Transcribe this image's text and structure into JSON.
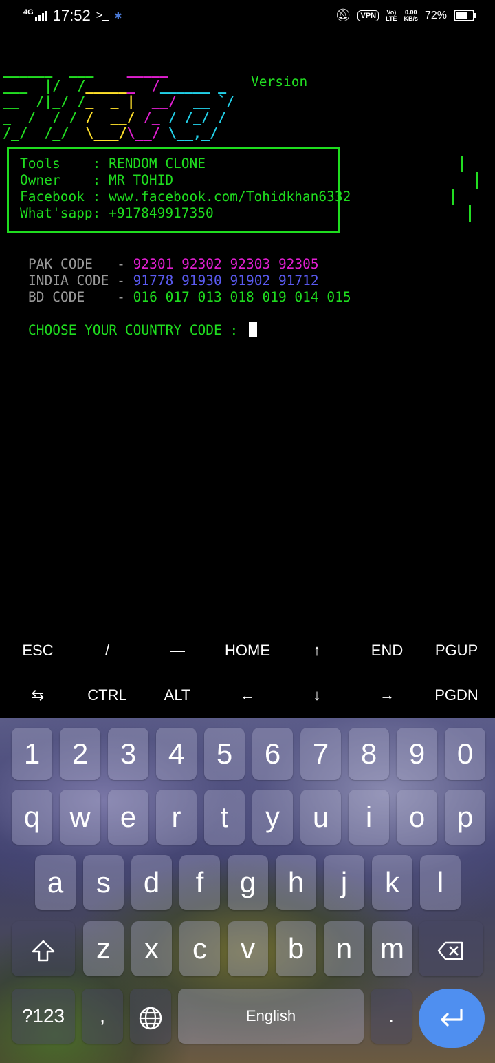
{
  "status_bar": {
    "network": "4G",
    "time": "17:52",
    "terminal_glyph": ">_",
    "vpn": "VPN",
    "volte_top": "Vo)",
    "volte_bottom": "LTE",
    "speed_top": "0.00",
    "speed_bottom": "KB/s",
    "battery": "72%",
    "battery_level": 0.72
  },
  "terminal": {
    "version_label": "Version",
    "info": {
      "tools": "Tools    : RENDOM CLONE",
      "owner": "Owner    : MR TOHID",
      "facebook": "Facebook : www.facebook.com/Tohidkhan6332",
      "whatsapp": "What'sapp: +917849917350"
    },
    "codes": [
      {
        "label": "PAK CODE   - ",
        "values": "92301 92302 92303 92305"
      },
      {
        "label": "INDIA CODE - ",
        "values": "91778 91930 91902 91712"
      },
      {
        "label": "BD CODE    - ",
        "values": "016 017 013 018 019 014 015"
      }
    ],
    "prompt": "CHOOSE YOUR COUNTRY CODE : "
  },
  "extra_keys": {
    "row1": [
      "ESC",
      "/",
      "—",
      "HOME",
      "↑",
      "END",
      "PGUP"
    ],
    "row2": [
      "⇆",
      "CTRL",
      "ALT",
      "←",
      "↓",
      "→",
      "PGDN"
    ]
  },
  "keyboard": {
    "numbers": [
      "1",
      "2",
      "3",
      "4",
      "5",
      "6",
      "7",
      "8",
      "9",
      "0"
    ],
    "row1": [
      "q",
      "w",
      "e",
      "r",
      "t",
      "y",
      "u",
      "i",
      "o",
      "p"
    ],
    "row2": [
      "a",
      "s",
      "d",
      "f",
      "g",
      "h",
      "j",
      "k",
      "l"
    ],
    "row3": [
      "z",
      "x",
      "c",
      "v",
      "b",
      "n",
      "m"
    ],
    "symbols_key": "?123",
    "comma_key": ",",
    "space_label": "English",
    "period_key": ".",
    "icons": {
      "shift": "shift-icon",
      "backspace": "backspace-icon",
      "globe": "globe-icon",
      "enter": "enter-icon"
    },
    "enter_color": "#4f8ff0"
  }
}
